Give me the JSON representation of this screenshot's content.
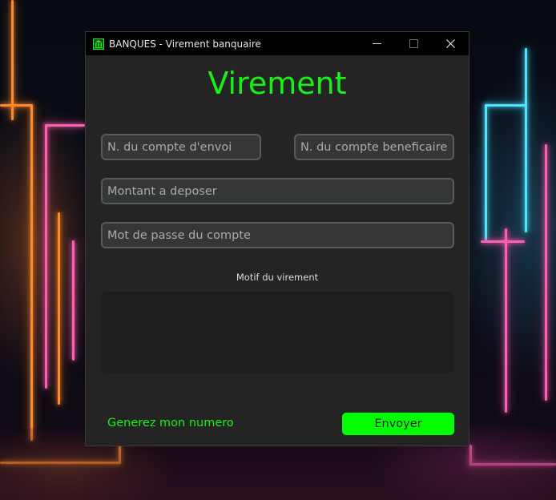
{
  "window": {
    "title": "BANQUES - Virement banquaire",
    "controls": {
      "minimize": "—",
      "maximize": "☐",
      "close": "✕"
    }
  },
  "form": {
    "heading": "Virement",
    "sender_account_placeholder": "N. du compte d'envoi",
    "beneficiary_account_placeholder": "N. du compte beneficaire",
    "amount_placeholder": "Montant a deposer",
    "password_placeholder": "Mot de passe du compte",
    "motif_label": "Motif du virement",
    "motif_value": ""
  },
  "footer": {
    "generate_link": "Generez mon numero",
    "send_button": "Envoyer"
  },
  "colors": {
    "accent": "#16f216",
    "button_bg": "#00ff00",
    "window_bg": "#242424",
    "titlebar_bg": "#000000",
    "field_bg": "#343638",
    "textbox_bg": "#1d1e1e"
  },
  "icons": {
    "app": "bank-building-icon"
  }
}
